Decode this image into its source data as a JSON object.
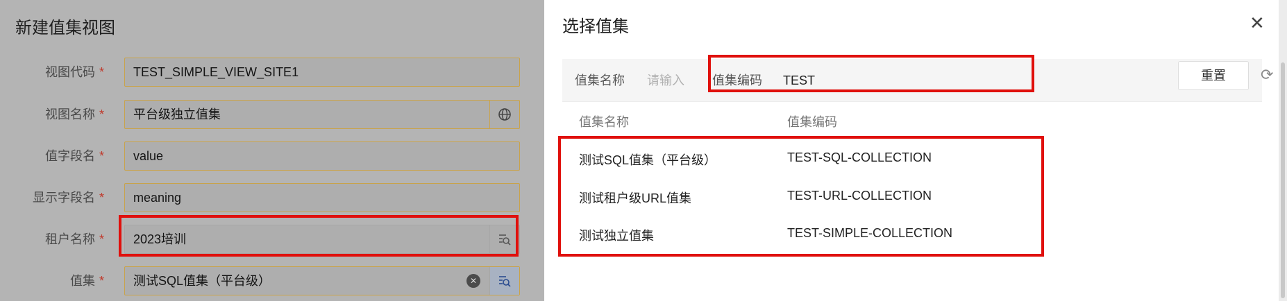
{
  "form": {
    "title": "新建值集视图",
    "required_mark": "*",
    "fields": [
      {
        "label": "视图代码",
        "value": "TEST_SIMPLE_VIEW_SITE1"
      },
      {
        "label": "视图名称",
        "value": "平台级独立值集"
      },
      {
        "label": "值字段名",
        "value": "value"
      },
      {
        "label": "显示字段名",
        "value": "meaning"
      },
      {
        "label": "租户名称",
        "value": "2023培训"
      },
      {
        "label": "值集",
        "value": "测试SQL值集（平台级）"
      }
    ]
  },
  "modal": {
    "title": "选择值集",
    "close_icon": "close-icon",
    "search": {
      "name_label": "值集名称",
      "name_placeholder": "请输入",
      "code_label": "值集编码",
      "code_value": "TEST",
      "reset_label": "重置",
      "refresh_icon": "refresh-icon"
    },
    "table": {
      "headers": [
        "值集名称",
        "值集编码"
      ],
      "rows": [
        {
          "name": "测试SQL值集（平台级）",
          "code": "TEST-SQL-COLLECTION"
        },
        {
          "name": "测试租户级URL值集",
          "code": "TEST-URL-COLLECTION"
        },
        {
          "name": "测试独立值集",
          "code": "TEST-SIMPLE-COLLECTION"
        }
      ]
    }
  },
  "colors": {
    "highlight": "#e0100c",
    "required": "#c0392b"
  }
}
